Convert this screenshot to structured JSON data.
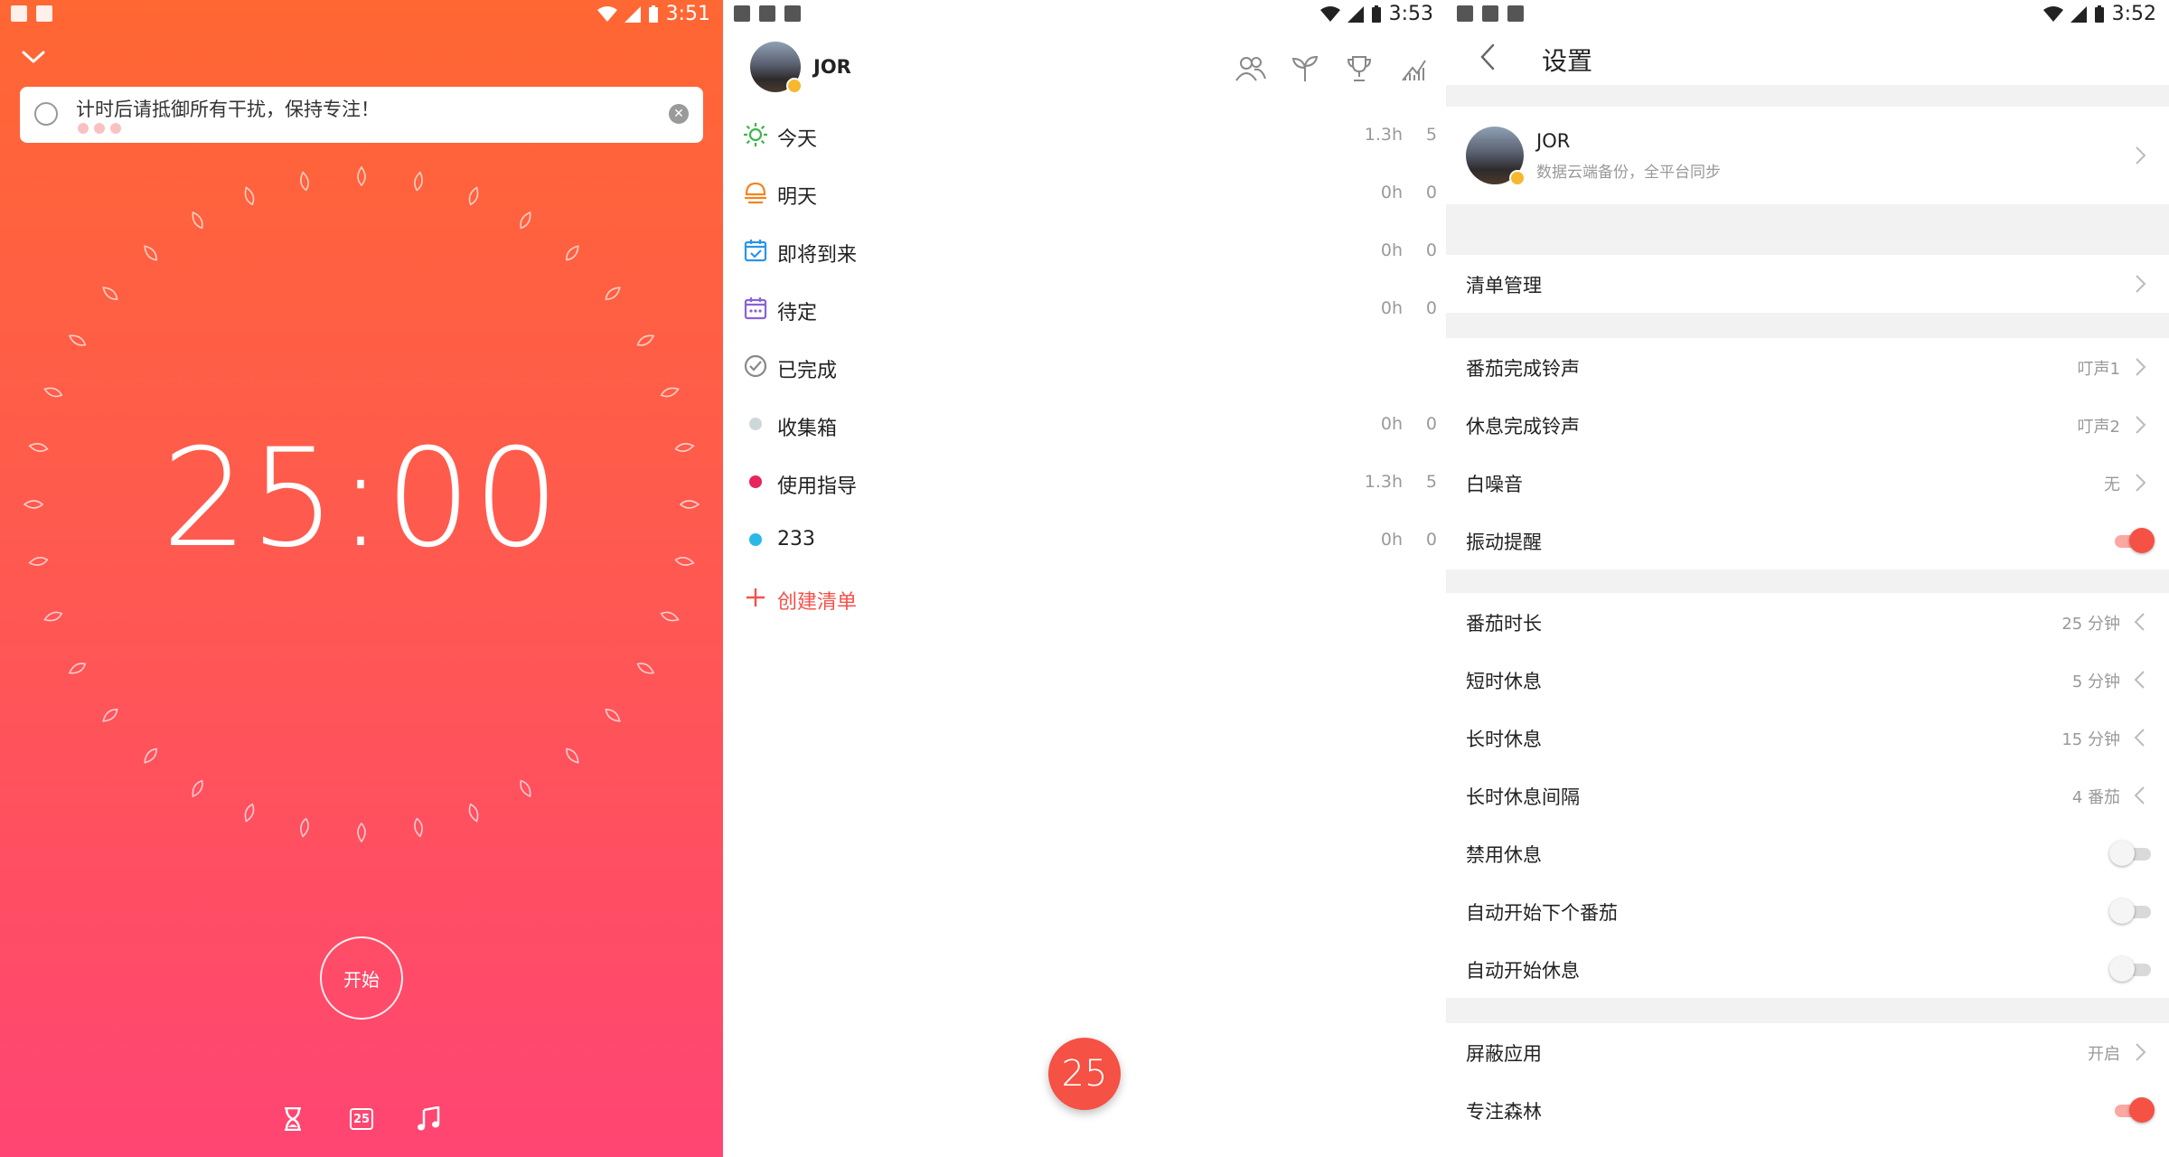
{
  "colors": {
    "accent": "#f55144",
    "timer_top": "#ff6733",
    "timer_bottom": "#ff4573"
  },
  "timer_screen": {
    "status_time": "3:51",
    "task_text": "计时后请抵御所有干扰，保持专注！",
    "time_display": "25:00",
    "start_label": "开始",
    "calendar_badge": "25",
    "bottom_icons": [
      "hourglass-icon",
      "calendar-icon",
      "music-note-icon"
    ]
  },
  "lists_screen": {
    "status_time": "3:53",
    "user_name": "JOR",
    "toolbar_icons": [
      "people-icon",
      "sprout-icon",
      "trophy-icon",
      "stats-icon"
    ],
    "items": [
      {
        "label": "今天",
        "hours": "1.3h",
        "count": "5",
        "icon": "sun-icon",
        "color": "#3cb54a"
      },
      {
        "label": "明天",
        "hours": "0h",
        "count": "0",
        "icon": "sunrise-icon",
        "color": "#f5831f"
      },
      {
        "label": "即将到来",
        "hours": "0h",
        "count": "0",
        "icon": "calendar-check-icon",
        "color": "#2a95e8"
      },
      {
        "label": "待定",
        "hours": "0h",
        "count": "0",
        "icon": "calendar-dots-icon",
        "color": "#8a62d8"
      },
      {
        "label": "已完成",
        "hours": "",
        "count": "",
        "icon": "check-circle-icon",
        "color": "#888888"
      },
      {
        "label": "收集箱",
        "hours": "0h",
        "count": "0",
        "icon": "dot-icon",
        "color": "#cfd8d8"
      },
      {
        "label": "使用指导",
        "hours": "1.3h",
        "count": "5",
        "icon": "dot-icon",
        "color": "#e8245c"
      },
      {
        "label": "233",
        "hours": "0h",
        "count": "0",
        "icon": "dot-icon",
        "color": "#2bb8e8"
      }
    ],
    "create_label": "创建清单",
    "fab_label": "25"
  },
  "settings_screen": {
    "status_time": "3:52",
    "title": "设置",
    "profile": {
      "name": "JOR",
      "subtitle": "数据云端备份，全平台同步"
    },
    "list_manage": "清单管理",
    "sound": {
      "pomodoro_done": {
        "label": "番茄完成铃声",
        "value": "叮声1"
      },
      "break_done": {
        "label": "休息完成铃声",
        "value": "叮声2"
      },
      "white_noise": {
        "label": "白噪音",
        "value": "无"
      },
      "vibrate": {
        "label": "振动提醒",
        "on": true
      }
    },
    "durations": {
      "pomodoro": {
        "label": "番茄时长",
        "value": "25 分钟"
      },
      "short_break": {
        "label": "短时休息",
        "value": "5 分钟"
      },
      "long_break": {
        "label": "长时休息",
        "value": "15 分钟"
      },
      "long_interval": {
        "label": "长时休息间隔",
        "value": "4 番茄"
      },
      "disable_break": {
        "label": "禁用休息",
        "on": false
      },
      "auto_next": {
        "label": "自动开始下个番茄",
        "on": false
      },
      "auto_break": {
        "label": "自动开始休息",
        "on": false
      }
    },
    "block_apps": {
      "label": "屏蔽应用",
      "value": "开启"
    },
    "forest": {
      "label": "专注森林",
      "on": true
    }
  }
}
